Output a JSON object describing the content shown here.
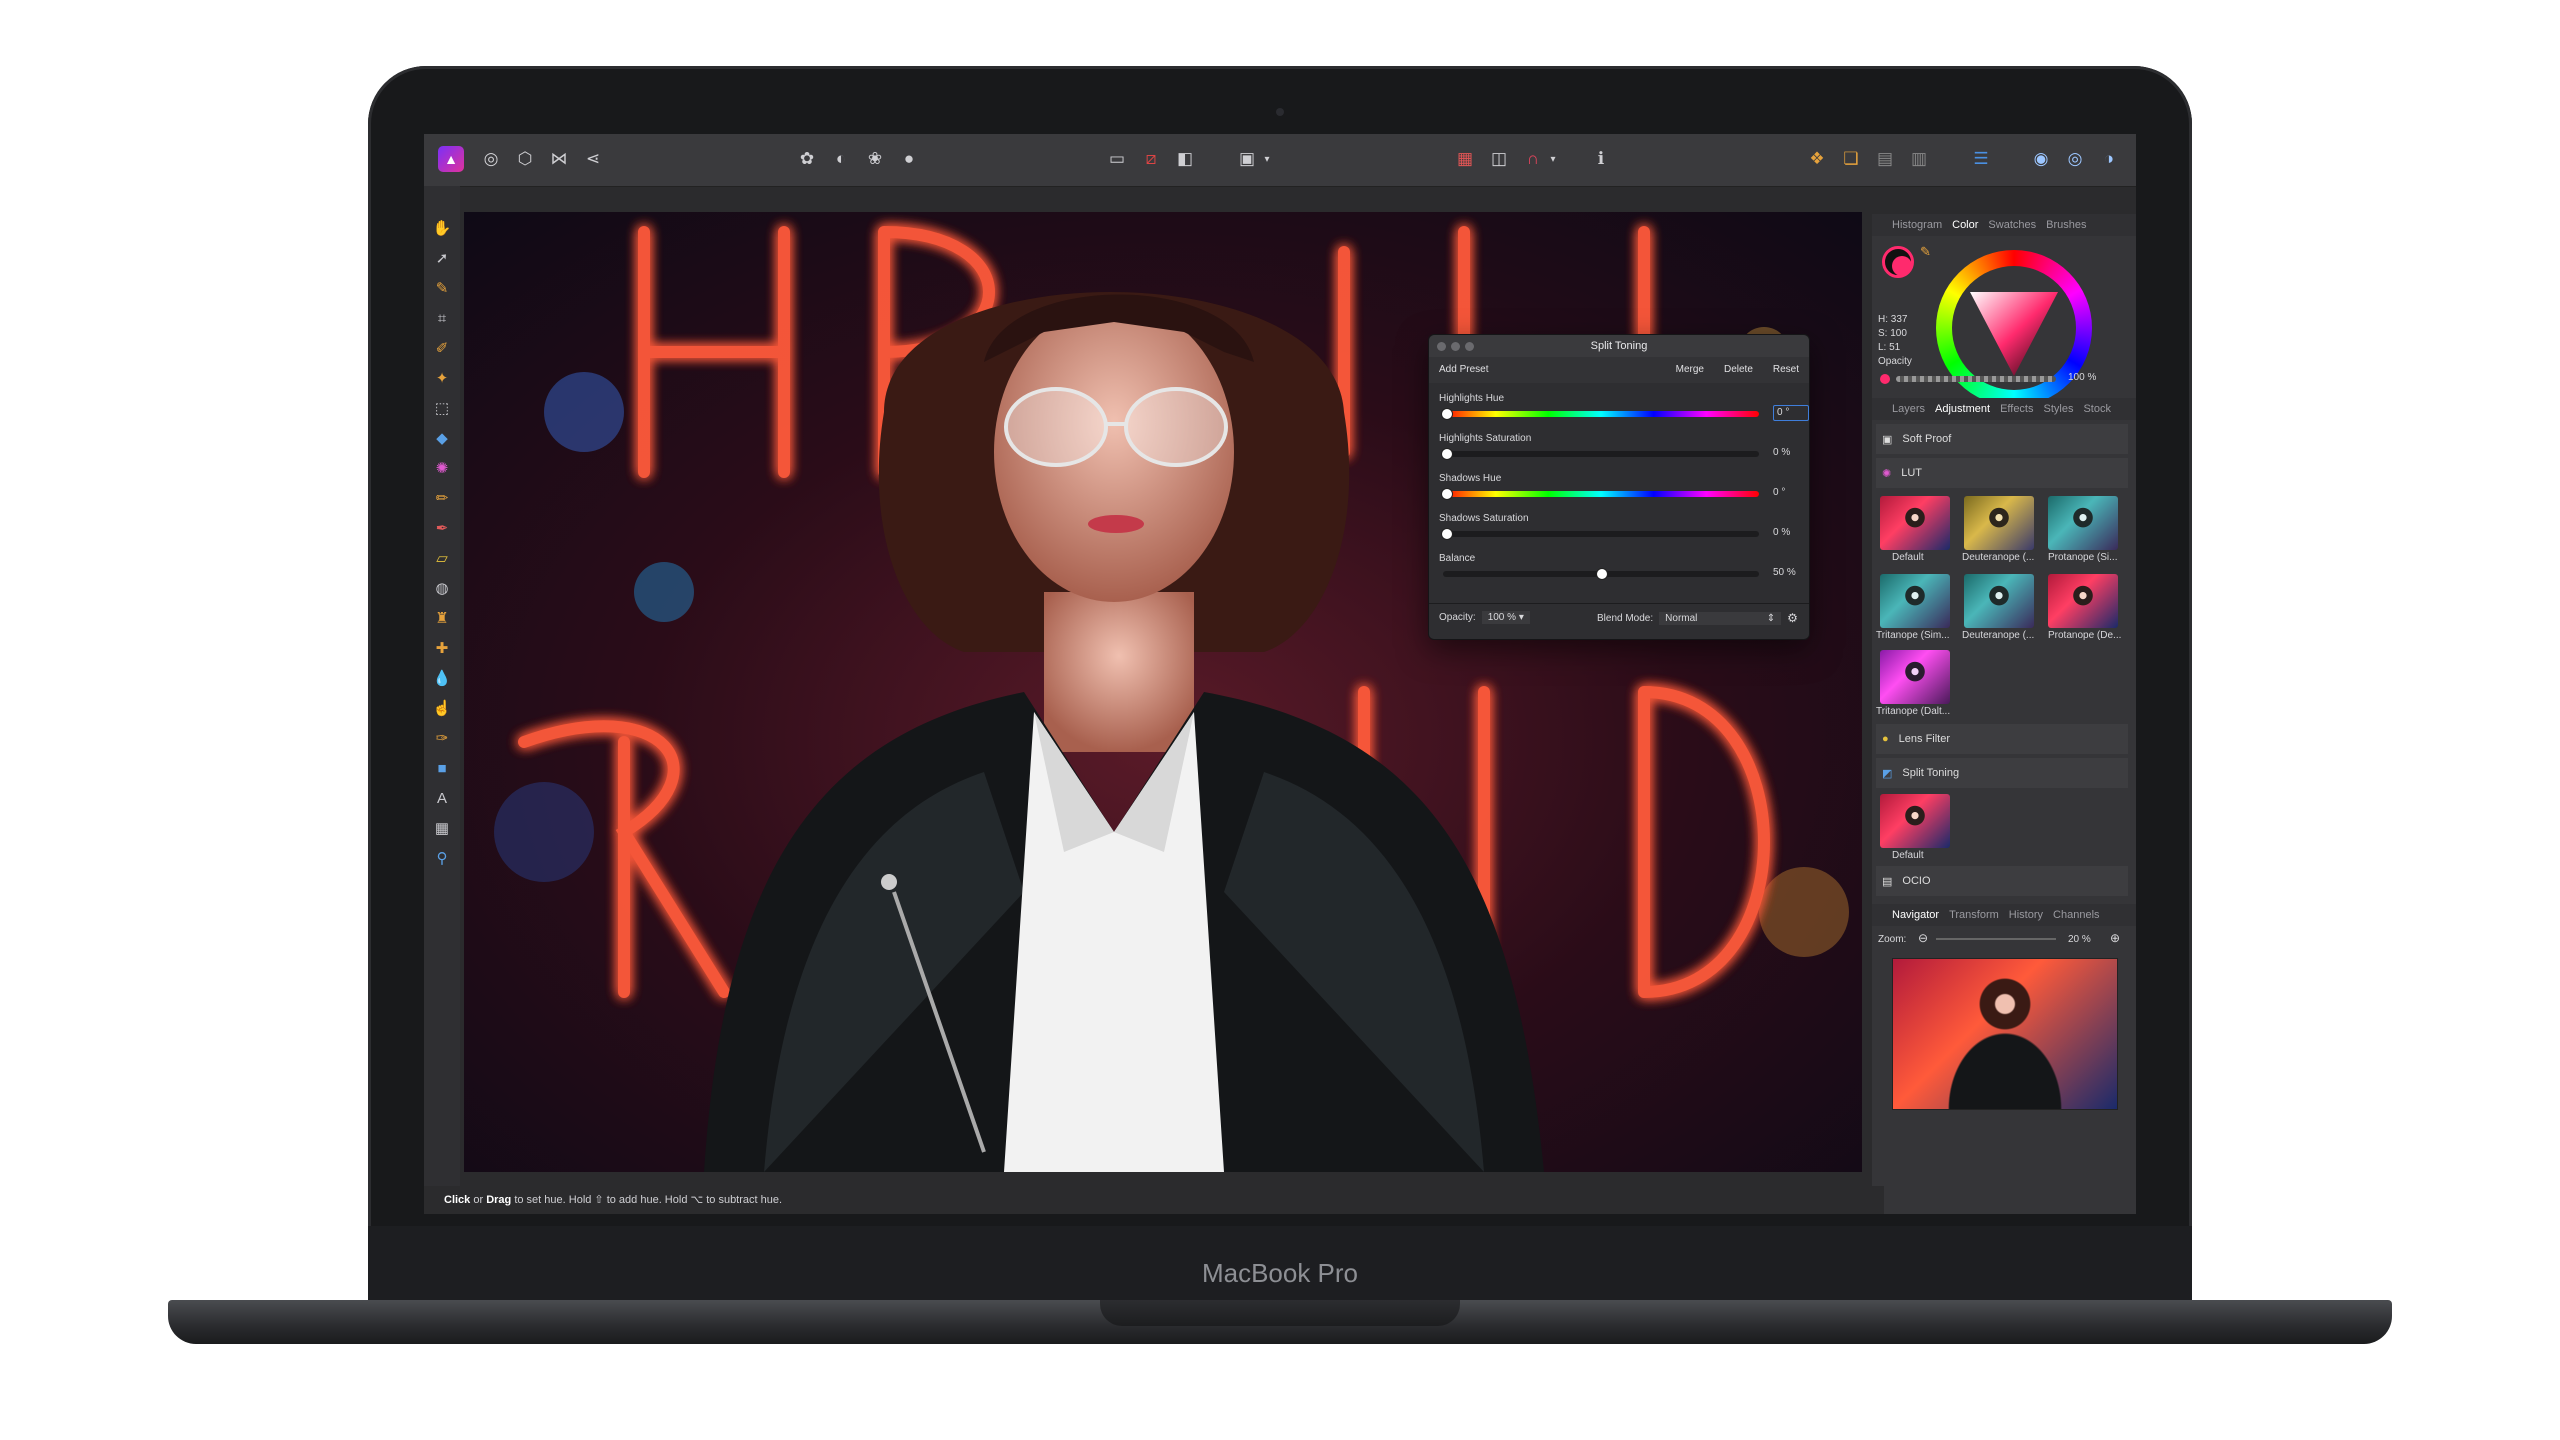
{
  "device": {
    "brand_label": "MacBook Pro"
  },
  "status_bar": {
    "hint_click": "Click",
    "hint_or": "or",
    "hint_drag": "Drag",
    "hint_rest": "to set hue. Hold ⇧ to add hue. Hold ⌥ to subtract hue."
  },
  "color_panel": {
    "tabs": [
      "Histogram",
      "Color",
      "Swatches",
      "Brushes"
    ],
    "active_tab": "Color",
    "h_readout": "H: 337",
    "s_readout": "S: 100",
    "l_readout": "L: 51",
    "opacity_label": "Opacity",
    "opacity_value": "100 %"
  },
  "adjustment_panel": {
    "tabs": [
      "Layers",
      "Adjustment",
      "Effects",
      "Styles",
      "Stock"
    ],
    "active_tab": "Adjustment",
    "soft_proof": "Soft Proof",
    "lut": "LUT",
    "thumbs_row1": [
      "Default",
      "Deuteranope (...",
      "Protanope (Si..."
    ],
    "thumbs_row2": [
      "Tritanope (Sim...",
      "Deuteranope (...",
      "Protanope (De..."
    ],
    "thumbs_row3": [
      "Tritanope (Dalt..."
    ],
    "lens_filter": "Lens Filter",
    "split_toning": "Split Toning",
    "split_default": "Default",
    "ocio": "OCIO"
  },
  "navigator_panel": {
    "tabs": [
      "Navigator",
      "Transform",
      "History",
      "Channels"
    ],
    "active_tab": "Navigator",
    "zoom_label": "Zoom:",
    "zoom_value": "20 %"
  },
  "split_toning_dialog": {
    "title": "Split Toning",
    "add_preset": "Add Preset",
    "merge": "Merge",
    "delete": "Delete",
    "reset": "Reset",
    "highlights_hue_label": "Highlights Hue",
    "highlights_hue_value": "0 °",
    "highlights_sat_label": "Highlights Saturation",
    "highlights_sat_value": "0 %",
    "shadows_hue_label": "Shadows Hue",
    "shadows_hue_value": "0 °",
    "shadows_sat_label": "Shadows Saturation",
    "shadows_sat_value": "0 %",
    "balance_label": "Balance",
    "balance_value": "50 %",
    "balance_level": 0.5,
    "opacity_label": "Opacity:",
    "opacity_value": "100 %",
    "blend_label": "Blend Mode:",
    "blend_value": "Normal"
  },
  "accent_colors": {
    "selection": "#ff2a6d",
    "highlight_box": "#3f7edb"
  },
  "icons": [
    "hand-icon",
    "move-icon",
    "pen-icon",
    "crop-icon",
    "brush-icon",
    "fill-icon",
    "text-icon",
    "zoom-icon",
    "persona-icon",
    "gear-icon"
  ]
}
